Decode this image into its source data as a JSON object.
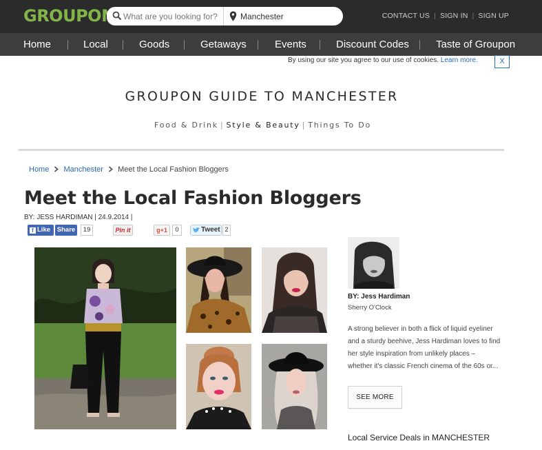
{
  "header": {
    "logo": "GROUPON",
    "search_placeholder": "What are you looking for?",
    "location_value": "Manchester",
    "account_links": [
      "CONTACT US",
      "SIGN IN",
      "SIGN UP"
    ]
  },
  "nav": {
    "items": [
      "Home",
      "Local",
      "Goods",
      "Getaways",
      "Events",
      "Discount Codes",
      "Taste of Groupon"
    ]
  },
  "cookie": {
    "text": "By using our site you agree to our use of cookies.",
    "link": "Learn more.",
    "close": "X"
  },
  "guide": {
    "title": "GROUPON GUIDE TO MANCHESTER",
    "categories": [
      "Food & Drink",
      "Style & Beauty",
      "Things To Do"
    ]
  },
  "breadcrumb": [
    "Home",
    "Manchester",
    "Meet the Local Fashion Bloggers"
  ],
  "article": {
    "title": "Meet the Local Fashion Bloggers",
    "byline": "BY: JESS HARDIMAN | 24.9.2014 |"
  },
  "social": {
    "like": "Like",
    "share": "Share",
    "share_count": "19",
    "pinit": "Pin it",
    "gplus": "g+1",
    "gplus_count": "0",
    "tweet": "Tweet",
    "tweet_count": "2"
  },
  "author": {
    "by": "BY: Jess Hardiman",
    "blog": "Sherry O'Clock",
    "bio": "A strong believer in both a flick of liquid eyeliner and a sturdy beehive, Jess Hardiman loves to find her style inspiration from unlikely places – whether it's classic French cinema of the 60s or...",
    "see_more": "SEE MORE"
  },
  "sidebar": {
    "deals_heading": "Local Service Deals in MANCHESTER"
  },
  "colors": {
    "brand_green": "#82b548",
    "topbar": "#2b2b2b",
    "nav": "#3d3d3d",
    "link_blue": "#2a6bb0"
  }
}
